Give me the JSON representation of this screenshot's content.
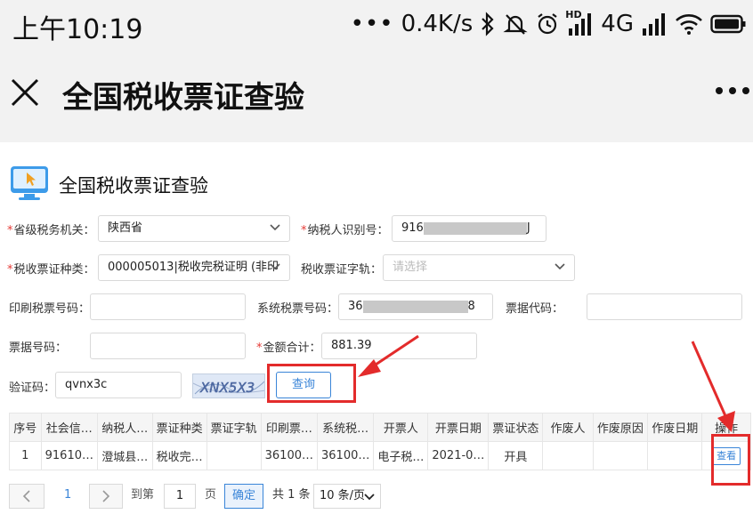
{
  "status_bar": {
    "time": "上午10:19",
    "dots": "•••",
    "speed": "0.4K/s",
    "network": "4G",
    "hd": "HD",
    "icons": [
      "bluetooth-icon",
      "mute-icon",
      "alarm-icon",
      "signal-icon",
      "wifi-icon",
      "battery-icon"
    ]
  },
  "titlebar": {
    "title": "全国税收票证查验"
  },
  "page": {
    "header_title": "全国税收票证查验",
    "fields": {
      "province_label": "省级税务机关：",
      "province_value": "陕西省",
      "taxpayer_id_label": "纳税人识别号：",
      "taxpayer_id_prefix": "916",
      "taxpayer_id_suffix": "J",
      "ticket_type_label": "税收票证种类：",
      "ticket_type_value": "000005013|税收完税证明 (非印",
      "ticket_track_label": "税收票证字轨：",
      "ticket_track_placeholder": "请选择",
      "print_no_label": "印刷税票号码：",
      "system_no_label": "系统税票号码：",
      "system_no_prefix": "36",
      "system_no_suffix": "8",
      "bill_code_label": "票据代码：",
      "bill_no_label": "票据号码：",
      "amount_label": "金额合计：",
      "amount_value": "881.39",
      "captcha_label": "验证码：",
      "captcha_value": "qvnx3c",
      "captcha_image_text": "XNX5X3"
    },
    "query_button": "查询"
  },
  "table": {
    "headers": [
      "序号",
      "社会信…",
      "纳税人…",
      "票证种类",
      "票证字轨",
      "印刷票…",
      "系统税…",
      "开票人",
      "开票日期",
      "票证状态",
      "作废人",
      "作废原因",
      "作废日期",
      "操作"
    ],
    "rows": [
      {
        "index": "1",
        "social_credit": "91610…",
        "taxpayer": "澄城县…",
        "ticket_type": "税收完…",
        "ticket_track": "",
        "print_no": "36100…",
        "system_no": "36100…",
        "issuer": "电子税…",
        "issue_date": "2021-0…",
        "status": "开具",
        "void_by": "",
        "void_reason": "",
        "void_date": "",
        "action": "查看"
      }
    ]
  },
  "pagination": {
    "current_page": "1",
    "goto_label": "到第",
    "page_input": "1",
    "page_unit": "页",
    "confirm": "确定",
    "total": "共 1 条",
    "page_size": "10 条/页"
  },
  "colors": {
    "accent": "#3a85d8",
    "required": "#e53935",
    "highlight": "#e32b2b",
    "bar_bg": "#f2f2f2"
  }
}
